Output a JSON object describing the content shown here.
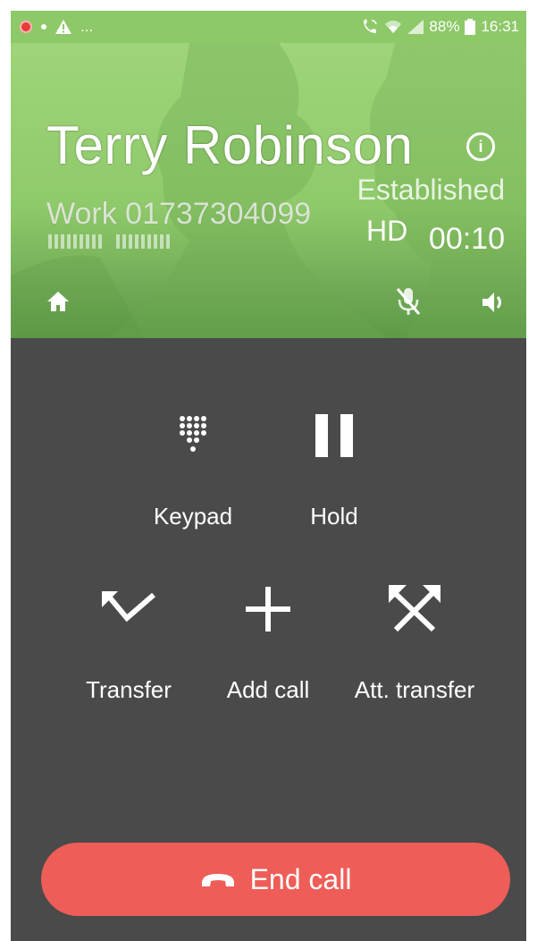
{
  "status_bar": {
    "battery": "88%",
    "time": "16:31",
    "ellipsis": "...",
    "icons": [
      "record-icon",
      "dot-icon",
      "warning-icon",
      "wifi-call-icon",
      "wifi-icon",
      "signal-icon",
      "battery-icon"
    ]
  },
  "call": {
    "contact_name": "Terry Robinson",
    "number_label": "Work 01737304099",
    "status": "Established",
    "quality": "HD",
    "duration": "00:10"
  },
  "actions": {
    "keypad": "Keypad",
    "hold": "Hold",
    "transfer": "Transfer",
    "add_call": "Add call",
    "att_transfer": "Att. transfer"
  },
  "end_call": {
    "label": "End call"
  },
  "colors": {
    "header_green": "#8fca6a",
    "background": "#4a4a4a",
    "end_call_red": "#ee5d57"
  }
}
